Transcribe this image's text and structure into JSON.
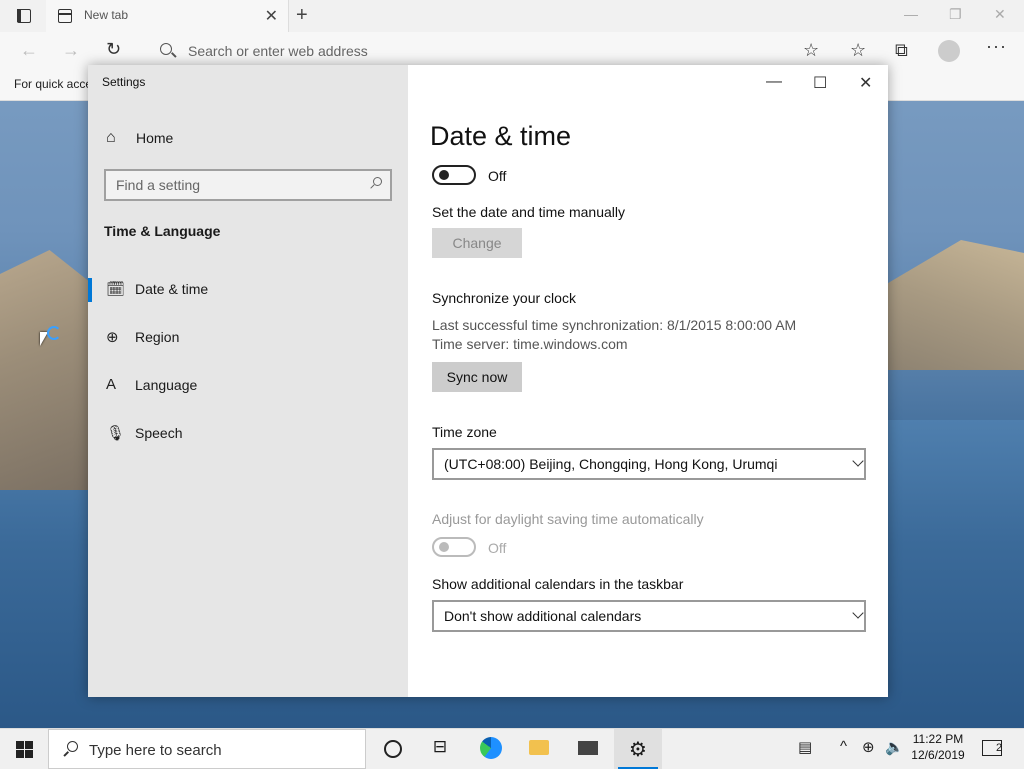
{
  "browser": {
    "tab_title": "New tab",
    "address_placeholder": "Search or enter web address",
    "favorites_bar_text": "For quick acce"
  },
  "settings": {
    "window_title": "Settings",
    "sidebar": {
      "home_label": "Home",
      "search_placeholder": "Find a setting",
      "section_title": "Time & Language",
      "items": [
        {
          "label": "Date & time",
          "icon": "calendar-clock-icon",
          "selected": true
        },
        {
          "label": "Region",
          "icon": "globe-icon",
          "selected": false
        },
        {
          "label": "Language",
          "icon": "language-icon",
          "selected": false
        },
        {
          "label": "Speech",
          "icon": "microphone-icon",
          "selected": false
        }
      ]
    },
    "content": {
      "title": "Date & time",
      "set_time_auto_toggle_state": "Off",
      "set_manually_label": "Set the date and time manually",
      "change_button": "Change",
      "sync_heading": "Synchronize your clock",
      "last_sync": "Last successful time synchronization: 8/1/2015 8:00:00 AM",
      "time_server": "Time server: time.windows.com",
      "sync_button": "Sync now",
      "time_zone_label": "Time zone",
      "time_zone_value": "(UTC+08:00) Beijing, Chongqing, Hong Kong, Urumqi",
      "dst_label": "Adjust for daylight saving time automatically",
      "dst_toggle_state": "Off",
      "calendars_label": "Show additional calendars in the taskbar",
      "calendars_value": "Don't show additional calendars"
    }
  },
  "taskbar": {
    "search_placeholder": "Type here to search",
    "time": "11:22 PM",
    "date": "12/6/2019",
    "notification_count": "2"
  },
  "colors": {
    "accent": "#0078d7",
    "sidebar_bg": "#e6e6e6",
    "taskbar_bg": "#f0f0f0"
  }
}
